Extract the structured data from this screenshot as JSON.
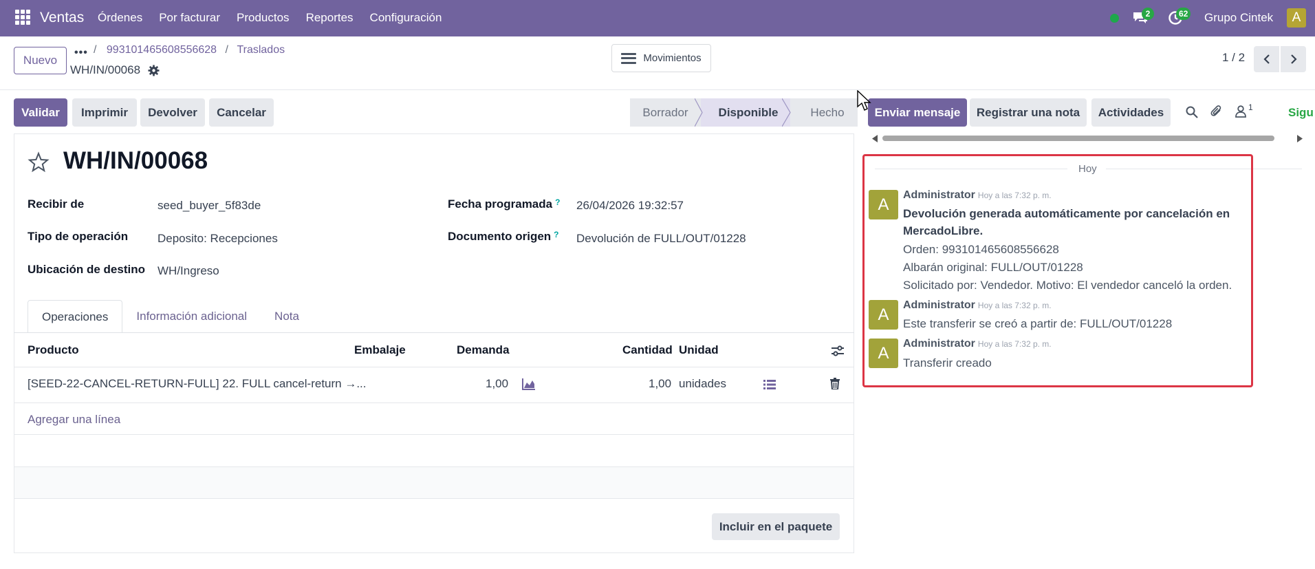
{
  "navbar": {
    "app_name": "Ventas",
    "menu": [
      "Órdenes",
      "Por facturar",
      "Productos",
      "Reportes",
      "Configuración"
    ],
    "chat_count": "2",
    "activity_count": "62",
    "company": "Grupo Cintek",
    "user_initial": "A"
  },
  "control": {
    "new_label": "Nuevo",
    "breadcrumb": [
      "993101465608556628",
      "Traslados"
    ],
    "record_name": "WH/IN/00068",
    "movements_label": "Movimientos",
    "pager": "1 / 2"
  },
  "actions": {
    "validate": "Validar",
    "print": "Imprimir",
    "return": "Devolver",
    "cancel": "Cancelar"
  },
  "statusbar": {
    "stages": [
      "Borrador",
      "Disponible",
      "Hecho"
    ],
    "active": "Disponible"
  },
  "form": {
    "title": "WH/IN/00068",
    "fields": {
      "partner_label": "Recibir de",
      "partner_value": "seed_buyer_5f83de",
      "op_type_label": "Tipo de operación",
      "op_type_value": "Deposito: Recepciones",
      "dest_label": "Ubicación de destino",
      "dest_value": "WH/Ingreso",
      "date_label": "Fecha programada",
      "date_value": "26/04/2026 19:32:57",
      "origin_label": "Documento origen",
      "origin_value": "Devolución de FULL/OUT/01228",
      "help_mark": "?"
    },
    "tabs": [
      "Operaciones",
      "Información adicional",
      "Nota"
    ],
    "table": {
      "headers": {
        "product": "Producto",
        "packaging": "Embalaje",
        "demand": "Demanda",
        "quantity": "Cantidad",
        "unit": "Unidad"
      },
      "rows": [
        {
          "product": "[SEED-22-CANCEL-RETURN-FULL] 22. FULL cancel-return →...",
          "demand": "1,00",
          "quantity": "1,00",
          "unit": "unidades"
        }
      ],
      "add_line": "Agregar una línea"
    },
    "pack_button": "Incluir en el paquete"
  },
  "chatter": {
    "send_message": "Enviar mensaje",
    "log_note": "Registrar una nota",
    "activities": "Actividades",
    "followers_count": "1",
    "follow_partial": "Sigu",
    "day_separator": "Hoy",
    "messages": [
      {
        "author": "Administrator",
        "time": "Hoy a las 7:32 p. m.",
        "initial": "A",
        "bold_lines": [
          "Devolución generada automáticamente por cancelación en",
          "MercadoLibre."
        ],
        "lines": [
          "Orden: 993101465608556628",
          "Albarán original: FULL/OUT/01228",
          "Solicitado por: Vendedor. Motivo: El vendedor canceló la orden."
        ]
      },
      {
        "author": "Administrator",
        "time": "Hoy a las 7:32 p. m.",
        "initial": "A",
        "lines": [
          "Este transferir se creó a partir de: FULL/OUT/01228"
        ]
      },
      {
        "author": "Administrator",
        "time": "Hoy a las 7:32 p. m.",
        "initial": "A",
        "lines": [
          "Transferir creado"
        ]
      }
    ]
  },
  "colors": {
    "brand": "#71639e",
    "online": "#1ea84b",
    "badge": "#28a745",
    "avatar": "#a2a33a",
    "highlight": "#dc3545",
    "follow": "#28a745"
  }
}
